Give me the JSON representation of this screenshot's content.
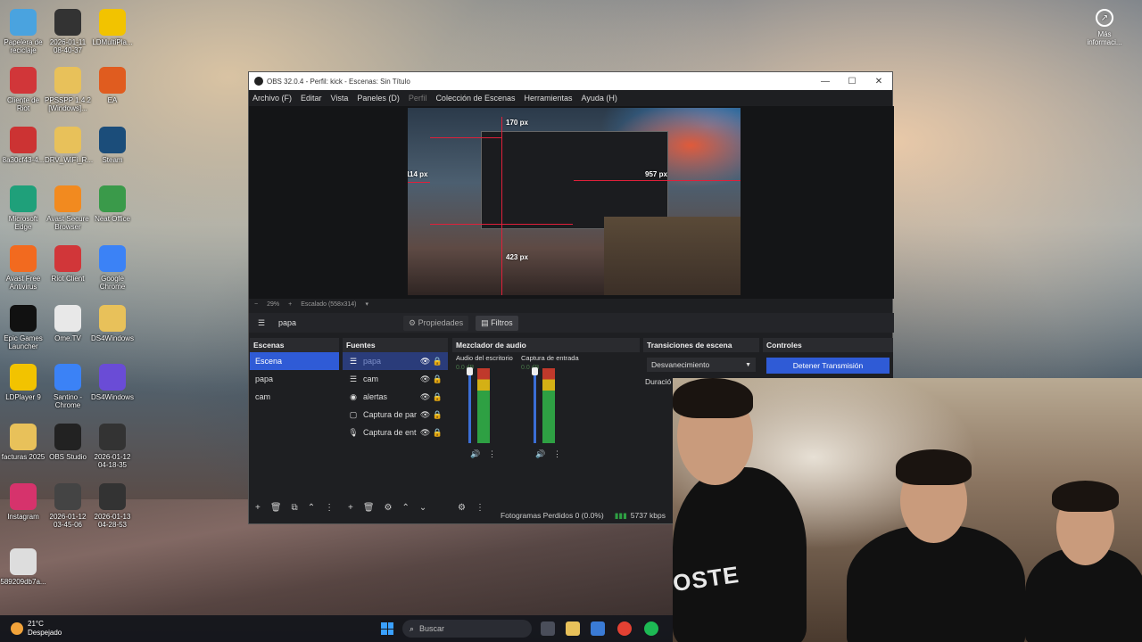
{
  "desktop": {
    "icons": [
      {
        "label": "Papelera de\nreciclaje",
        "color": "#4aa3df",
        "glyph": "recycle-bin-icon"
      },
      {
        "label": "2026-01-11\n08-40-37",
        "color": "#333333",
        "glyph": "video-thumbnail-icon"
      },
      {
        "label": "LDMultiPla...",
        "color": "#f2c300",
        "glyph": "ldmultiplayer-icon"
      },
      {
        "label": "Cliente de\nRiot",
        "color": "#d13639",
        "glyph": "riot-icon"
      },
      {
        "label": "PPSSPP 1.4.2\n[Windows]...",
        "color": "#e8c15a",
        "glyph": "folder-icon"
      },
      {
        "label": "EA",
        "color": "#e05c1f",
        "glyph": "ea-icon"
      },
      {
        "label": "8a30cf43-4...",
        "color": "#cc3333",
        "glyph": "file-icon"
      },
      {
        "label": "DRV_WiFi_R...",
        "color": "#e8c15a",
        "glyph": "folder-icon"
      },
      {
        "label": "Steam",
        "color": "#1b4d7a",
        "glyph": "steam-icon"
      },
      {
        "label": "Microsoft\nEdge",
        "color": "#1fa07a",
        "glyph": "edge-icon"
      },
      {
        "label": "Avast Secure\nBrowser",
        "color": "#f28a1f",
        "glyph": "avast-browser-icon"
      },
      {
        "label": "Neat Office",
        "color": "#3a9a4a",
        "glyph": "neat-office-icon"
      },
      {
        "label": "Avast Free\nAntivirus",
        "color": "#f26a1f",
        "glyph": "avast-icon"
      },
      {
        "label": "Riot Client",
        "color": "#d13639",
        "glyph": "riot-icon"
      },
      {
        "label": "Google\nChrome",
        "color": "#3b82f6",
        "glyph": "chrome-icon"
      },
      {
        "label": "Epic Games\nLauncher",
        "color": "#111111",
        "glyph": "epic-icon"
      },
      {
        "label": "Ome.TV",
        "color": "#e8e8e8",
        "glyph": "ometv-icon"
      },
      {
        "label": "DS4Windows",
        "color": "#e8c15a",
        "glyph": "folder-icon"
      },
      {
        "label": "LDPlayer 9",
        "color": "#f2c300",
        "glyph": "ldplayer-icon"
      },
      {
        "label": "Santino -\nChrome",
        "color": "#3b82f6",
        "glyph": "chrome-icon"
      },
      {
        "label": "DS4Windows",
        "color": "#6a4cd6",
        "glyph": "gamepad-icon"
      },
      {
        "label": "facturas 2025",
        "color": "#e8c15a",
        "glyph": "folder-icon"
      },
      {
        "label": "OBS Studio",
        "color": "#222222",
        "glyph": "obs-icon"
      },
      {
        "label": "2026-01-12\n04-18-35",
        "color": "#333333",
        "glyph": "video-thumbnail-icon"
      },
      {
        "label": "Instagram",
        "color": "#d6336c",
        "glyph": "instagram-icon"
      },
      {
        "label": "2026-01-12\n03-45-06",
        "color": "#444444",
        "glyph": "video-thumbnail-icon"
      },
      {
        "label": "2026-01-13\n04-28-53",
        "color": "#333333",
        "glyph": "video-thumbnail-icon"
      },
      {
        "label": "589209db7a...",
        "color": "#dddddd",
        "glyph": "image-file-icon"
      }
    ],
    "top_right": {
      "label": "Más\ninformaci..."
    }
  },
  "obs": {
    "title": "OBS 32.0.4 - Perfil: kick - Escenas: Sin Título",
    "menu": [
      {
        "label": "Archivo (F)",
        "dim": false
      },
      {
        "label": "Editar",
        "dim": false
      },
      {
        "label": "Vista",
        "dim": false
      },
      {
        "label": "Paneles (D)",
        "dim": false
      },
      {
        "label": "Perfil",
        "dim": true
      },
      {
        "label": "Colección de Escenas",
        "dim": false
      },
      {
        "label": "Herramientas",
        "dim": false
      },
      {
        "label": "Ayuda (H)",
        "dim": false
      }
    ],
    "preview": {
      "px_top": "170 px",
      "px_right": "957 px",
      "px_left": "114 px",
      "px_bottom": "423 px"
    },
    "scale": {
      "zoom": "29%",
      "mode": "Escalado (558x314)"
    },
    "context": {
      "scene_name": "papa",
      "properties": "Propiedades",
      "filters": "Filtros"
    },
    "scenes": {
      "title": "Escenas",
      "items": [
        "Escena",
        "papa",
        "cam"
      ]
    },
    "sources": {
      "title": "Fuentes",
      "items": [
        {
          "label": "papa",
          "icon": "list-icon"
        },
        {
          "label": "cam",
          "icon": "list-icon"
        },
        {
          "label": "alertas",
          "icon": "globe-icon"
        },
        {
          "label": "Captura de par",
          "icon": "monitor-icon"
        },
        {
          "label": "Captura de ent",
          "icon": "mic-icon"
        }
      ]
    },
    "mixer": {
      "title": "Mezclador de audio",
      "channels": [
        {
          "name": "Audio del escritorio",
          "db": "0.0 dB"
        },
        {
          "name": "Captura de entrada",
          "db": "0.0 dB"
        }
      ]
    },
    "transitions": {
      "title": "Transiciones de escena",
      "selected": "Desvanecimiento",
      "duration_label": "Duració"
    },
    "controls": {
      "title": "Controles",
      "stream_button": "Detener Transmisión"
    },
    "status": {
      "dropped": "Fotogramas Perdidos 0 (0.0%)",
      "bitrate": "5737 kbps"
    }
  },
  "webcam": {
    "shirt_text": "OSTE"
  },
  "taskbar": {
    "weather_temp": "21°C",
    "weather_text": "Despejado",
    "search_placeholder": "Buscar"
  }
}
